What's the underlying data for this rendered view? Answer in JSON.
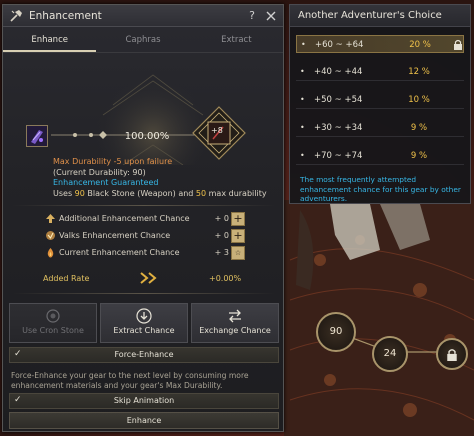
{
  "window": {
    "title": "Enhancement",
    "help_label": "?"
  },
  "tabs": [
    {
      "label": "Enhance",
      "active": true
    },
    {
      "label": "Caphras",
      "active": false
    },
    {
      "label": "Extract",
      "active": false
    }
  ],
  "enhance": {
    "success_rate": "100.00%",
    "target_level": "+8",
    "info_max_durability": "Max Durability -5 upon failure",
    "info_current_durability": "(Current Durability: 90)",
    "info_guaranteed": "Enhancement Guaranteed",
    "info_uses_prefix": "Uses ",
    "info_stone_count": "90",
    "info_uses_mid": " Black Stone (Weapon) and ",
    "info_durability_count": "50",
    "info_uses_suffix": " max durability"
  },
  "chances": [
    {
      "label": "Additional Enhancement Chance",
      "value": "+ 0",
      "icon": "arrow-up-icon",
      "has_button": true
    },
    {
      "label": "Valks Enhancement Chance",
      "value": "+ 0",
      "icon": "valks-icon",
      "has_button": true
    },
    {
      "label": "Current Enhancement Chance",
      "value": "+ 3",
      "icon": "flame-icon",
      "has_button": true
    }
  ],
  "added_rate": {
    "label": "Added Rate",
    "value": "+0.00%"
  },
  "actions": {
    "cron": "Use Cron Stone",
    "extract": "Extract Chance",
    "exchange": "Exchange Chance"
  },
  "force_enhance": {
    "label": "Force-Enhance",
    "checked": "✓",
    "description": "Force-Enhance your gear to the next level by consuming more enhancement materials and your gear's Max Durability."
  },
  "skip_animation": {
    "label": "Skip Animation",
    "checked": "✓"
  },
  "enhance_button": "Enhance",
  "choice": {
    "title": "Another Adventurer's Choice",
    "rows": [
      {
        "range": "+60 ~ +64",
        "pct": "20 %",
        "selected": true
      },
      {
        "range": "+40 ~ +44",
        "pct": "12 %",
        "selected": false
      },
      {
        "range": "+50 ~ +54",
        "pct": "10 %",
        "selected": false
      },
      {
        "range": "+30 ~ +34",
        "pct": "9 %",
        "selected": false
      },
      {
        "range": "+70 ~ +74",
        "pct": "9 %",
        "selected": false
      }
    ],
    "note": "The most frequently attempted enhancement chance for this gear by other adventurers."
  },
  "orbs": {
    "left": "90",
    "middle": "24"
  },
  "colors": {
    "accent_gold": "#c8b079",
    "highlight_yellow": "#f0c24a",
    "info_cyan": "#37b7e6",
    "info_orange": "#e0904a"
  }
}
